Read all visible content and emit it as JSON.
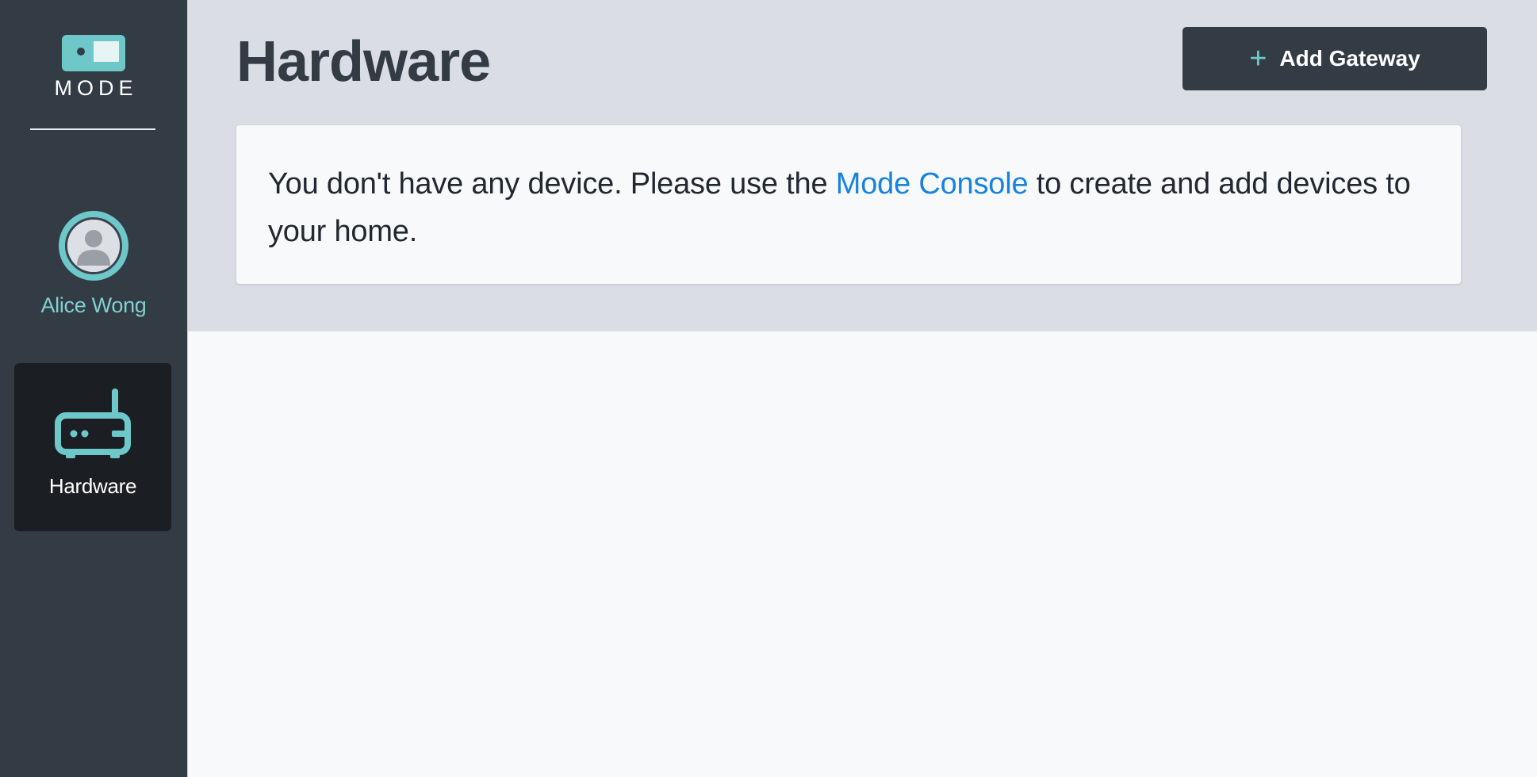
{
  "brand": {
    "name": "MODE",
    "accent_color": "#6ec8c9",
    "logo_icon": "toggle-switch-icon"
  },
  "sidebar": {
    "profile": {
      "name": "Alice Wong",
      "avatar_icon": "user-avatar-icon"
    },
    "items": [
      {
        "label": "Hardware",
        "icon": "router-icon",
        "active": true
      }
    ],
    "background_color": "#333b45",
    "active_item_color": "#1b1f23"
  },
  "header": {
    "title": "Hardware",
    "add_button": {
      "icon": "plus-icon",
      "label": "Add Gateway"
    }
  },
  "empty_state": {
    "text_before": "You don't have any device. Please use the ",
    "link_text": "Mode Console",
    "text_after": " to create and add devices to your home.",
    "link_color": "#1683e0"
  }
}
